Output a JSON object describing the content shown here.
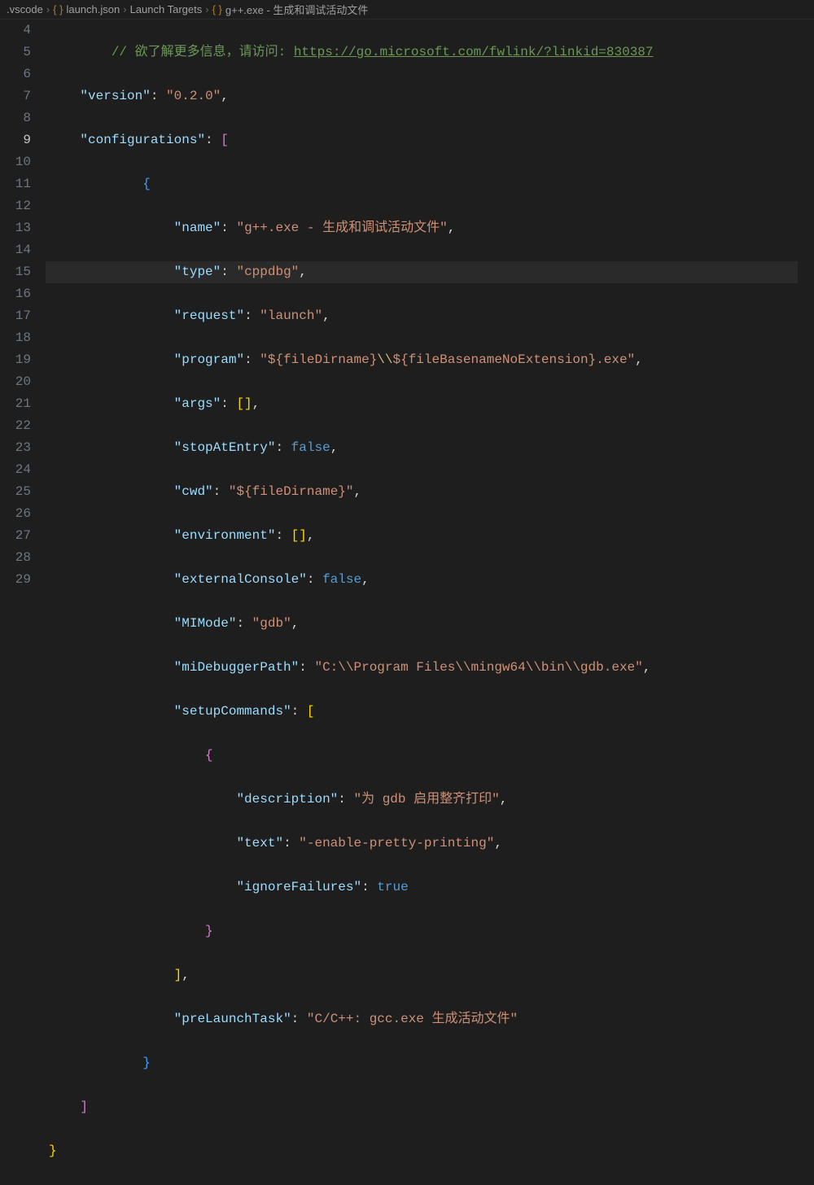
{
  "breadcrumb": {
    "folder": ".vscode",
    "file": "launch.json",
    "section": "Launch Targets",
    "target": "g++.exe - 生成和调试活动文件"
  },
  "lines": {
    "start": 4,
    "active": 9
  },
  "comment": {
    "prefix": "// 欲了解更多信息，请访问: ",
    "url": "https://go.microsoft.com/fwlink/?linkid=830387"
  },
  "json": {
    "version_key": "version",
    "version_val": "0.2.0",
    "configurations_key": "configurations",
    "name_key": "name",
    "name_val": "g++.exe - 生成和调试活动文件",
    "type_key": "type",
    "type_val": "cppdbg",
    "request_key": "request",
    "request_val": "launch",
    "program_key": "program",
    "program_val_pre": "${fileDirname}",
    "program_val_esc": "\\\\",
    "program_val_post": "${fileBasenameNoExtension}.exe",
    "args_key": "args",
    "stopAtEntry_key": "stopAtEntry",
    "stopAtEntry_val": "false",
    "cwd_key": "cwd",
    "cwd_val": "${fileDirname}",
    "environment_key": "environment",
    "externalConsole_key": "externalConsole",
    "externalConsole_val": "false",
    "MIMode_key": "MIMode",
    "MIMode_val": "gdb",
    "miDebuggerPath_key": "miDebuggerPath",
    "miDebuggerPath_val": "C:\\\\Program Files\\\\mingw64\\\\bin\\\\gdb.exe",
    "setupCommands_key": "setupCommands",
    "description_key": "description",
    "description_val": "为 gdb 启用整齐打印",
    "text_key": "text",
    "text_val": "-enable-pretty-printing",
    "ignoreFailures_key": "ignoreFailures",
    "ignoreFailures_val": "true",
    "preLaunchTask_key": "preLaunchTask",
    "preLaunchTask_val": "C/C++: gcc.exe 生成活动文件"
  }
}
